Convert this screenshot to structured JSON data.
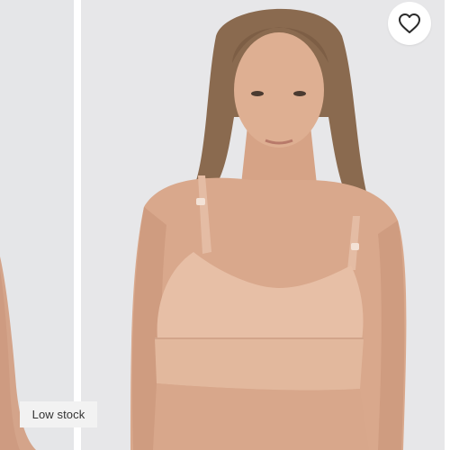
{
  "gallery": {
    "images": [
      {
        "name": "previous-product-photo",
        "description_icon": "product-photo"
      },
      {
        "name": "current-product-photo",
        "description_icon": "product-photo"
      }
    ],
    "favorite": {
      "icon": "heart-outline-icon"
    },
    "stock_badge": {
      "label": "Low stock"
    },
    "colors": {
      "background": "#e6e6e8",
      "garment": "#e7bfa6",
      "skin": "#d9a88c",
      "badge_bg": "#f2f2f2",
      "badge_text": "#333333"
    }
  }
}
